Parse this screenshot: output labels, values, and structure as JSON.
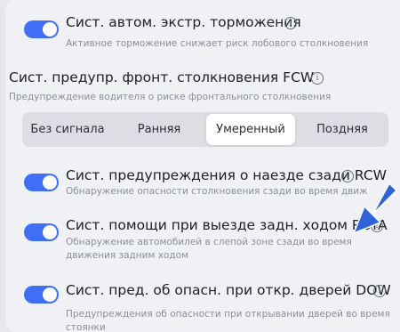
{
  "colors": {
    "accent": "#3e6ff5",
    "background": "#f0f1f5",
    "pointer_arrow": "#2f64d6"
  },
  "info_glyph": "i",
  "aeb": {
    "title": "Сист. автом. экстр. торможения",
    "subtitle": "Активное торможение снижает риск лобового столкновения",
    "enabled": true
  },
  "fcw": {
    "title": "Сист. предупр. фронт. столкновения FCW",
    "subtitle": "Предупреждение водителя о риске фронтального столкновения",
    "options": [
      "Без сигнала",
      "Ранняя",
      "Умеренный",
      "Поздняя"
    ],
    "selected": "Умеренный"
  },
  "rcw": {
    "title": "Сист. предупреждения о наезде сзади RCW",
    "subtitle": "Обнаружение опасности столкновения сзади во время движ",
    "enabled": true
  },
  "rcta": {
    "title": "Сист. помощи при выезде задн. ходом RCTA",
    "subtitle_line1": "Обнаружение автомобилей в слепой зоне сзади во время",
    "subtitle_line2": "движения задним ходом",
    "enabled": true
  },
  "dow": {
    "title": "Сист. пред. об опасн. при откр. дверей DOW",
    "subtitle_line1": "Предупреждения об опасности при открывании дверей во время",
    "subtitle_line2": "стоянки",
    "enabled": true
  }
}
